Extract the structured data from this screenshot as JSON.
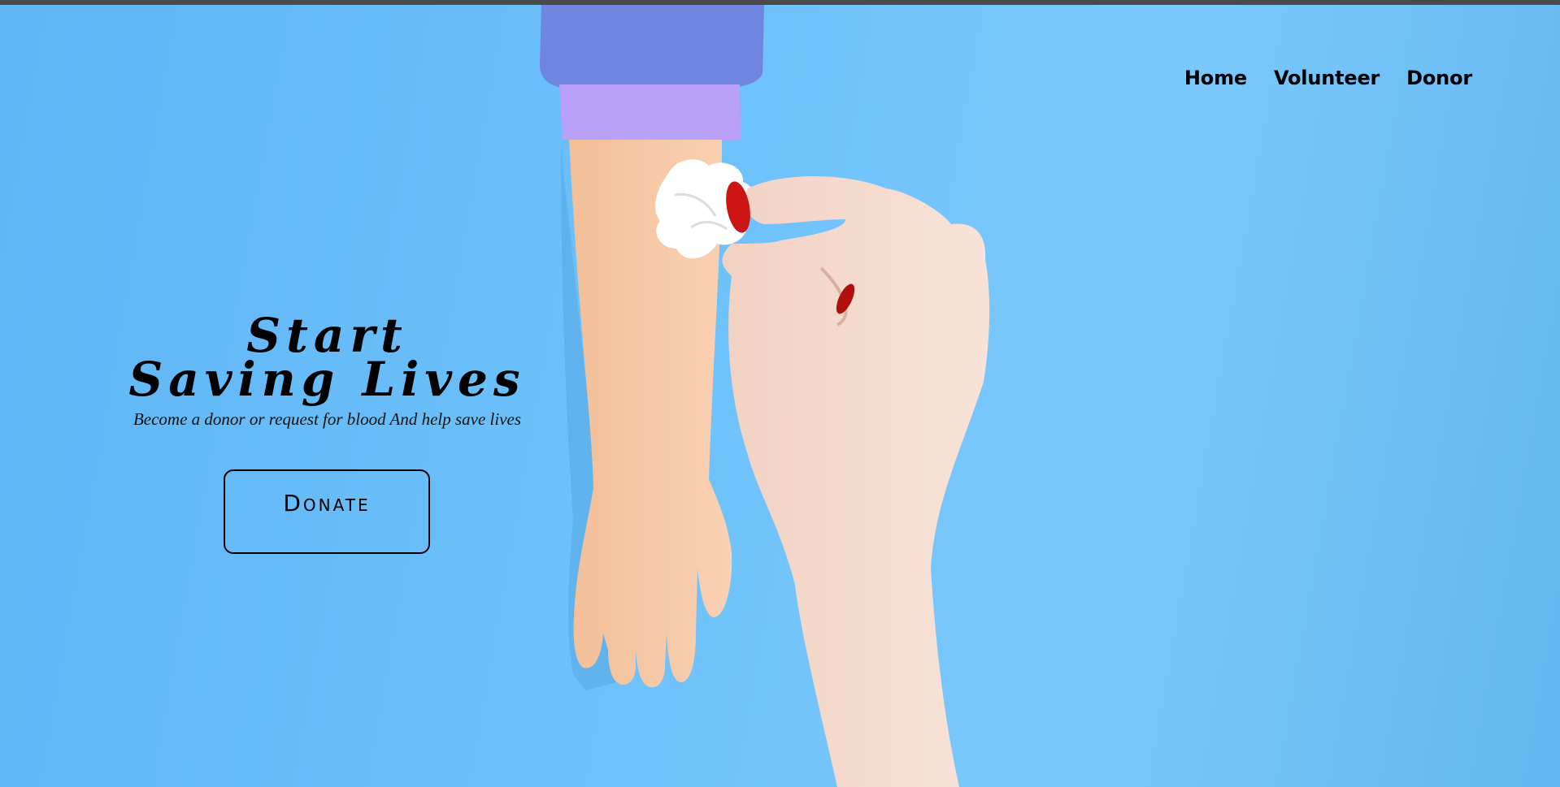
{
  "nav": {
    "items": [
      {
        "label": "Home"
      },
      {
        "label": "Volunteer"
      },
      {
        "label": "Donor"
      }
    ]
  },
  "hero": {
    "title_line1": "Start",
    "title_line2": "Saving Lives",
    "subtitle": "Become a donor or request for blood  And help save lives",
    "button_label": "Donate"
  },
  "colors": {
    "background": "#6cc0fb",
    "sleeve": "#7488e0",
    "cuff": "#b8a0f7",
    "arm": "#f6c8a3",
    "nail": "#d11a1a"
  }
}
